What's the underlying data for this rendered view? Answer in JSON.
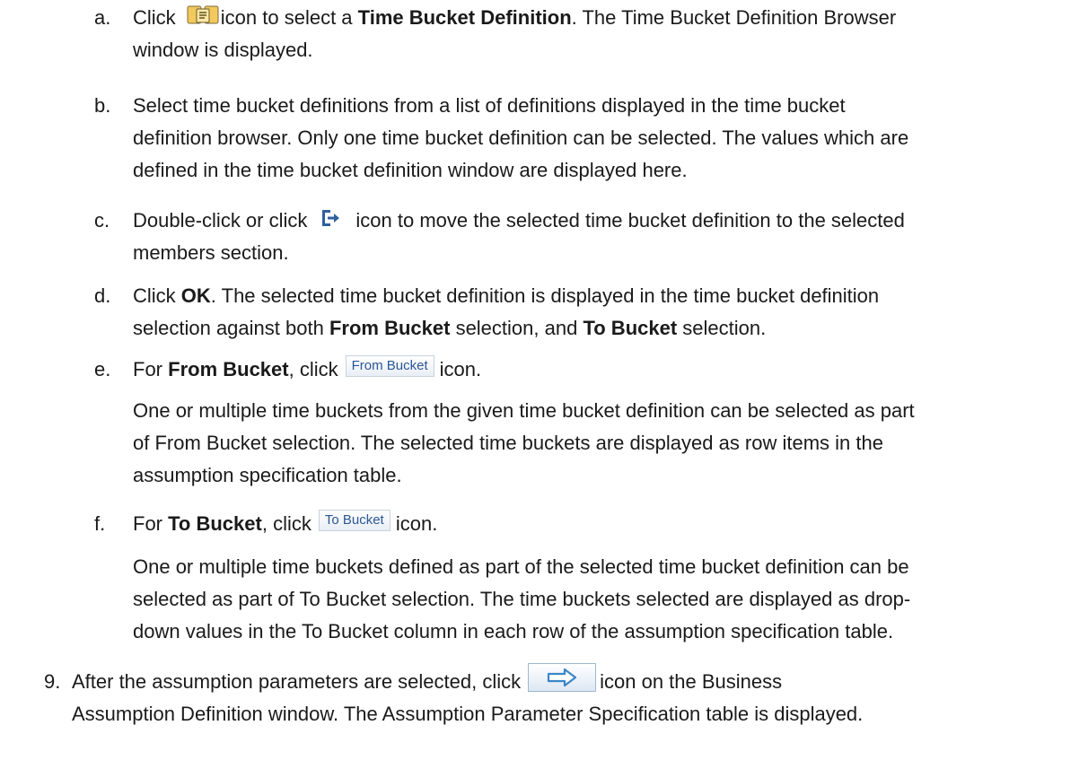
{
  "items": {
    "a": {
      "marker": "a.",
      "pre": "Click",
      "post": "icon to select a",
      "bold": "Time Bucket Definition",
      "rest": ". The Time Bucket Definition Browser",
      "line2": "window is displayed."
    },
    "b": {
      "marker": "b.",
      "lines": [
        "Select time bucket definitions from a list of definitions displayed in the time bucket",
        "definition browser. Only one time bucket definition can be selected. The values which are",
        "defined in the time bucket definition window are displayed here."
      ]
    },
    "c": {
      "marker": "c.",
      "pre": "Double-click or click",
      "post": "icon to move the selected time bucket definition to the selected",
      "line2": "members section."
    },
    "d": {
      "marker": "d.",
      "pre": "Click",
      "bold": "OK",
      "rest": ". The selected time bucket definition is displayed in the time bucket definition",
      "line2_pre": "selection against both",
      "line2_bold1": "From Bucket",
      "line2_mid": "selection, and",
      "line2_bold2": "To Bucket",
      "line2_post": "selection."
    },
    "e": {
      "marker": "e.",
      "pre": "For",
      "bold": "From Bucket",
      "mid": ", click",
      "button": "From Bucket",
      "post": "icon.",
      "para": [
        "One or multiple time buckets from the given time bucket definition can be selected as part",
        "of From Bucket selection. The selected time buckets are displayed as row items in the",
        "assumption specification table."
      ]
    },
    "f": {
      "marker": "f.",
      "pre": "For",
      "bold": "To Bucket",
      "mid": ", click",
      "button": "To Bucket",
      "post": "icon.",
      "para": [
        "One or multiple time buckets defined as part of the selected time bucket definition can be",
        "selected as part of To Bucket selection. The time buckets selected are displayed as drop-",
        "down values in the To Bucket column in each row of the assumption specification table."
      ]
    }
  },
  "step9": {
    "marker": "9.",
    "pre": "After the assumption parameters are selected, click",
    "post": "icon on the Business",
    "line2": "Assumption Definition window. The Assumption Parameter Specification table is displayed."
  },
  "icons": {
    "time_bucket_definition": "time-bucket-definition-icon",
    "move": "move-selected-icon",
    "next_arrow": "right-arrow-icon"
  },
  "colors": {
    "text": "#1a1a1a",
    "icon_gold": "#e8b84a",
    "icon_blue": "#3a6ea5",
    "button_text": "#2b5797"
  }
}
